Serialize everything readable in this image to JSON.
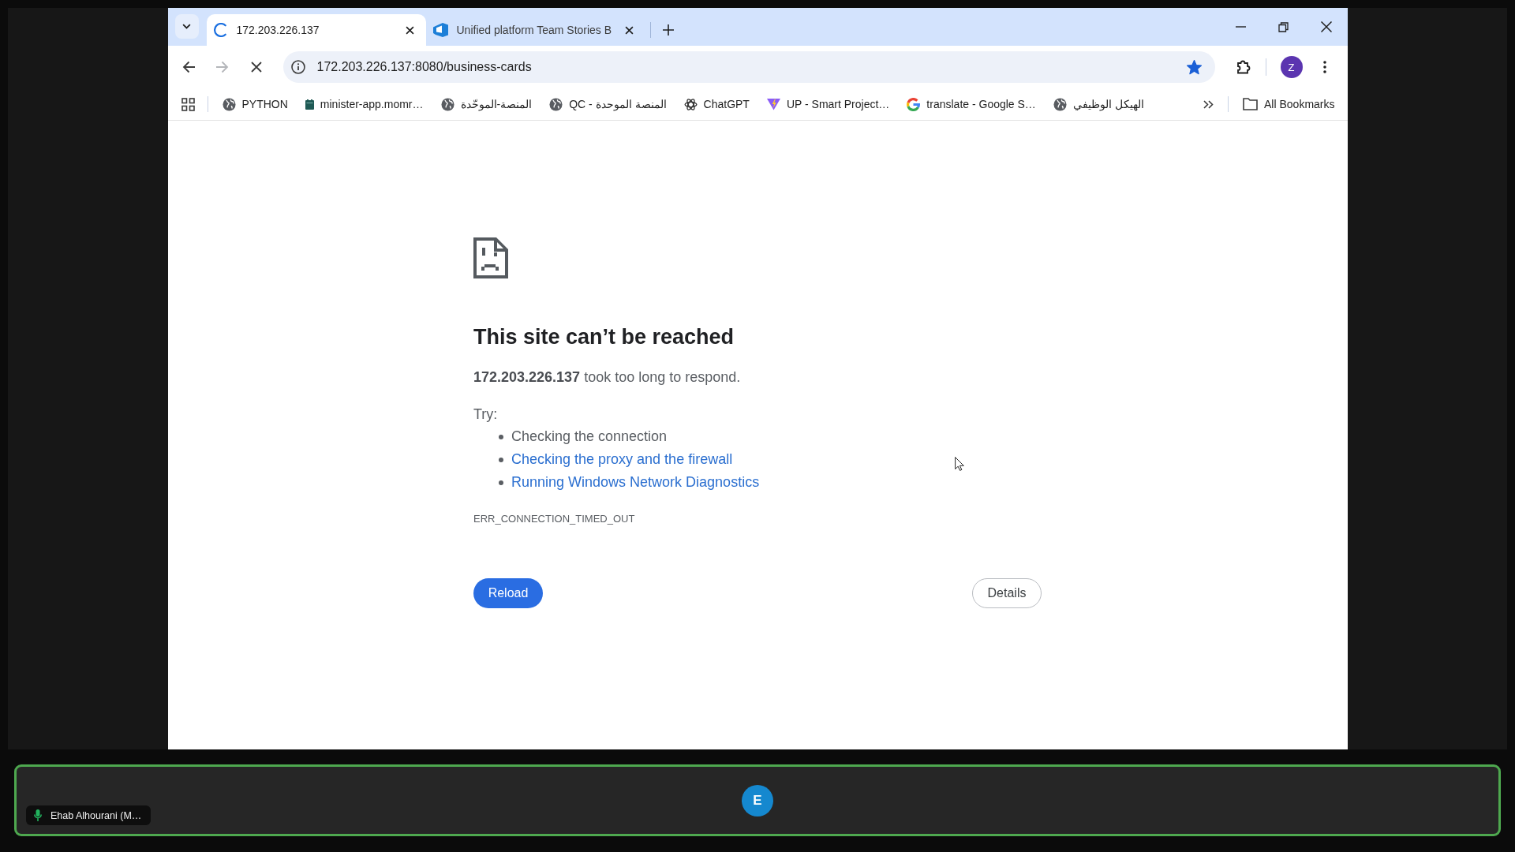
{
  "browser": {
    "tabs": [
      {
        "title": "172.203.226.137",
        "selected": true,
        "loading": true
      },
      {
        "title": "Unified platform Team Stories B",
        "selected": false,
        "loading": false
      }
    ],
    "navigation": {
      "forward_disabled": true
    },
    "address_bar": {
      "url": "172.203.226.137:8080/business-cards",
      "bookmarked": true
    },
    "profile": {
      "initial": "Z"
    },
    "bookmarks": [
      {
        "label": "PYTHON",
        "kind": "globe"
      },
      {
        "label": "minister-app.momr…",
        "kind": "calendar"
      },
      {
        "label": "المنصة-الموحّدة",
        "kind": "globe"
      },
      {
        "label": "QC - المنصة الموحدة",
        "kind": "globe"
      },
      {
        "label": "ChatGPT",
        "kind": "knot"
      },
      {
        "label": "UP - Smart Project…",
        "kind": "vee"
      },
      {
        "label": "translate - Google S…",
        "kind": "gletter"
      },
      {
        "label": "الهيكل الوظيفي",
        "kind": "globe"
      }
    ],
    "all_bookmarks": {
      "label": "All Bookmarks"
    }
  },
  "error_page": {
    "title": "This site can’t be reached",
    "message": "**172.203.226.137** took too long to respond.",
    "try_label": "Try:",
    "suggestions": [
      {
        "text": "Checking the connection",
        "kind": "text"
      },
      {
        "text": "Checking the proxy and the firewall",
        "kind": "link"
      },
      {
        "text": "Running Windows Network Diagnostics",
        "kind": "link"
      }
    ],
    "error_code": "ERR_CONNECTION_TIMED_OUT",
    "buttons": [
      {
        "label": "Reload",
        "kind": "reload"
      },
      {
        "label": "Details",
        "kind": "details"
      }
    ]
  },
  "call": {
    "participant": {
      "name": "Ehab Alhourani (M…",
      "initial": "E",
      "speaking": true,
      "mic_on": true
    }
  }
}
